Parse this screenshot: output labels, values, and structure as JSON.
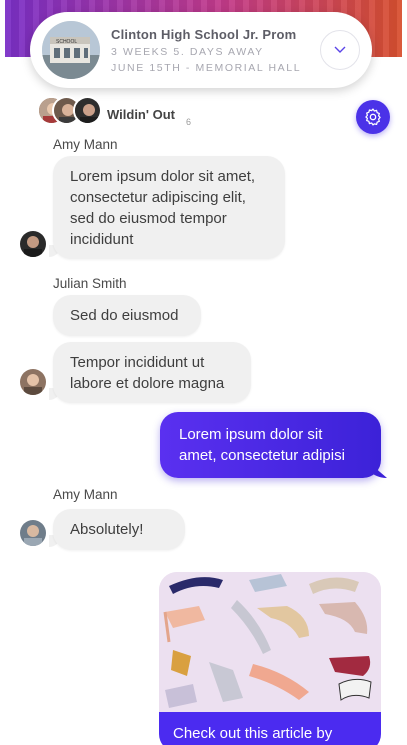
{
  "event": {
    "title": "Clinton High School Jr. Prom",
    "countdown": "3 WEEKS  5. DAYS AWAY",
    "details": "JUNE 15TH -  MEMORIAL  HALL",
    "thumbnail_text": "SCHOOL"
  },
  "group": {
    "name": "Wildin' Out",
    "member_count": "6"
  },
  "messages": [
    {
      "sender": "Amy Mann",
      "text": "Lorem ipsum dolor sit amet, consectetur adipiscing elit, sed do eiusmod tempor incididunt"
    },
    {
      "sender": "Julian Smith",
      "text": "Sed do eiusmod"
    },
    {
      "text": "Tempor incididunt ut labore et dolore magna"
    },
    {
      "text": "Lorem ipsum dolor sit amet, consectetur adipisi"
    },
    {
      "sender": "Amy Mann",
      "text": "Absolutely!"
    },
    {
      "caption": "Check out this article by"
    }
  ],
  "colors": {
    "accent": "#4b32e8",
    "bubble_in": "#f0f0f0",
    "header_gradient": [
      "#7a2fc7",
      "#d8502f"
    ]
  },
  "icons": [
    "chevron-down-icon",
    "gear-icon"
  ]
}
